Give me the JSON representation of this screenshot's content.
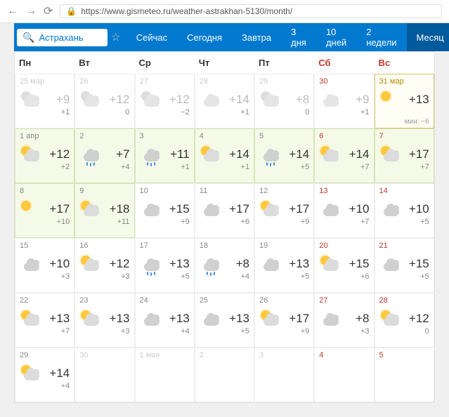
{
  "browser": {
    "url": "https://www.gismeteo.ru/weather-astrakhan-5130/month/"
  },
  "search": {
    "value": "Астрахань"
  },
  "tabs": [
    {
      "label": "Сейчас",
      "active": false
    },
    {
      "label": "Сегодня",
      "active": false
    },
    {
      "label": "Завтра",
      "active": false
    },
    {
      "label": "3 дня",
      "active": false
    },
    {
      "label": "10 дней",
      "active": false
    },
    {
      "label": "2 недели",
      "active": false
    },
    {
      "label": "Месяц",
      "active": true
    }
  ],
  "dow": [
    "Пн",
    "Вт",
    "Ср",
    "Чт",
    "Пт",
    "Сб",
    "Вс"
  ],
  "cells": [
    {
      "date": "25 мар",
      "hi": "+9",
      "lo": "+1",
      "icon": "partly",
      "kind": "past"
    },
    {
      "date": "26",
      "hi": "+12",
      "lo": "0",
      "icon": "partly",
      "kind": "past"
    },
    {
      "date": "27",
      "hi": "+12",
      "lo": "−2",
      "icon": "partly",
      "kind": "past"
    },
    {
      "date": "28",
      "hi": "+14",
      "lo": "+1",
      "icon": "cloudy",
      "kind": "past"
    },
    {
      "date": "29",
      "hi": "+8",
      "lo": "0",
      "icon": "partly",
      "kind": "past"
    },
    {
      "date": "30",
      "hi": "+9",
      "lo": "+1",
      "icon": "cloudy",
      "kind": "past",
      "weekend": true
    },
    {
      "date": "31 мар",
      "hi": "+13",
      "lo": "мин: −6",
      "icon": "sunny",
      "kind": "today",
      "weekend": true,
      "isToday": true
    },
    {
      "date": "1 апр",
      "hi": "+12",
      "lo": "+2",
      "icon": "partly",
      "kind": "range"
    },
    {
      "date": "2",
      "hi": "+7",
      "lo": "+4",
      "icon": "rain",
      "kind": "range"
    },
    {
      "date": "3",
      "hi": "+11",
      "lo": "+1",
      "icon": "rain",
      "kind": "range"
    },
    {
      "date": "4",
      "hi": "+14",
      "lo": "+1",
      "icon": "partly",
      "kind": "range"
    },
    {
      "date": "5",
      "hi": "+14",
      "lo": "+5",
      "icon": "rain",
      "kind": "range"
    },
    {
      "date": "6",
      "hi": "+14",
      "lo": "+7",
      "icon": "partly",
      "kind": "range",
      "weekend": true
    },
    {
      "date": "7",
      "hi": "+17",
      "lo": "+7",
      "icon": "partly",
      "kind": "range",
      "weekend": true
    },
    {
      "date": "8",
      "hi": "+17",
      "lo": "+10",
      "icon": "sunny",
      "kind": "range"
    },
    {
      "date": "9",
      "hi": "+18",
      "lo": "+11",
      "icon": "partly",
      "kind": "range"
    },
    {
      "date": "10",
      "hi": "+15",
      "lo": "+9",
      "icon": "cloudy",
      "kind": "future"
    },
    {
      "date": "11",
      "hi": "+17",
      "lo": "+6",
      "icon": "cloudy",
      "kind": "future"
    },
    {
      "date": "12",
      "hi": "+17",
      "lo": "+9",
      "icon": "partly",
      "kind": "future"
    },
    {
      "date": "13",
      "hi": "+10",
      "lo": "+7",
      "icon": "cloudy",
      "kind": "future",
      "weekend": true
    },
    {
      "date": "14",
      "hi": "+10",
      "lo": "+5",
      "icon": "cloudy",
      "kind": "future",
      "weekend": true
    },
    {
      "date": "15",
      "hi": "+10",
      "lo": "+3",
      "icon": "cloudy",
      "kind": "future"
    },
    {
      "date": "16",
      "hi": "+12",
      "lo": "+3",
      "icon": "partly",
      "kind": "future"
    },
    {
      "date": "17",
      "hi": "+13",
      "lo": "+5",
      "icon": "rain",
      "kind": "future"
    },
    {
      "date": "18",
      "hi": "+8",
      "lo": "+4",
      "icon": "rain",
      "kind": "future"
    },
    {
      "date": "19",
      "hi": "+13",
      "lo": "+5",
      "icon": "cloudy",
      "kind": "future"
    },
    {
      "date": "20",
      "hi": "+15",
      "lo": "+6",
      "icon": "partly",
      "kind": "future",
      "weekend": true
    },
    {
      "date": "21",
      "hi": "+15",
      "lo": "+5",
      "icon": "cloudy",
      "kind": "future",
      "weekend": true
    },
    {
      "date": "22",
      "hi": "+13",
      "lo": "+7",
      "icon": "partly",
      "kind": "future"
    },
    {
      "date": "23",
      "hi": "+13",
      "lo": "+3",
      "icon": "partly",
      "kind": "future"
    },
    {
      "date": "24",
      "hi": "+13",
      "lo": "+4",
      "icon": "cloudy",
      "kind": "future"
    },
    {
      "date": "25",
      "hi": "+13",
      "lo": "+5",
      "icon": "cloudy",
      "kind": "future"
    },
    {
      "date": "26",
      "hi": "+17",
      "lo": "+9",
      "icon": "partly",
      "kind": "future"
    },
    {
      "date": "27",
      "hi": "+8",
      "lo": "+3",
      "icon": "cloudy",
      "kind": "future",
      "weekend": true
    },
    {
      "date": "28",
      "hi": "+12",
      "lo": "0",
      "icon": "partly",
      "kind": "future",
      "weekend": true
    },
    {
      "date": "29",
      "hi": "+14",
      "lo": "+4",
      "icon": "partly",
      "kind": "future"
    },
    {
      "date": "30",
      "hi": "",
      "lo": "",
      "icon": "",
      "kind": "ghost"
    },
    {
      "date": "1 мая",
      "hi": "",
      "lo": "",
      "icon": "",
      "kind": "ghost"
    },
    {
      "date": "2",
      "hi": "",
      "lo": "",
      "icon": "",
      "kind": "ghost"
    },
    {
      "date": "3",
      "hi": "",
      "lo": "",
      "icon": "",
      "kind": "ghost"
    },
    {
      "date": "4",
      "hi": "",
      "lo": "",
      "icon": "",
      "kind": "ghost",
      "weekend": true
    },
    {
      "date": "5",
      "hi": "",
      "lo": "",
      "icon": "",
      "kind": "ghost",
      "weekend": true
    }
  ]
}
